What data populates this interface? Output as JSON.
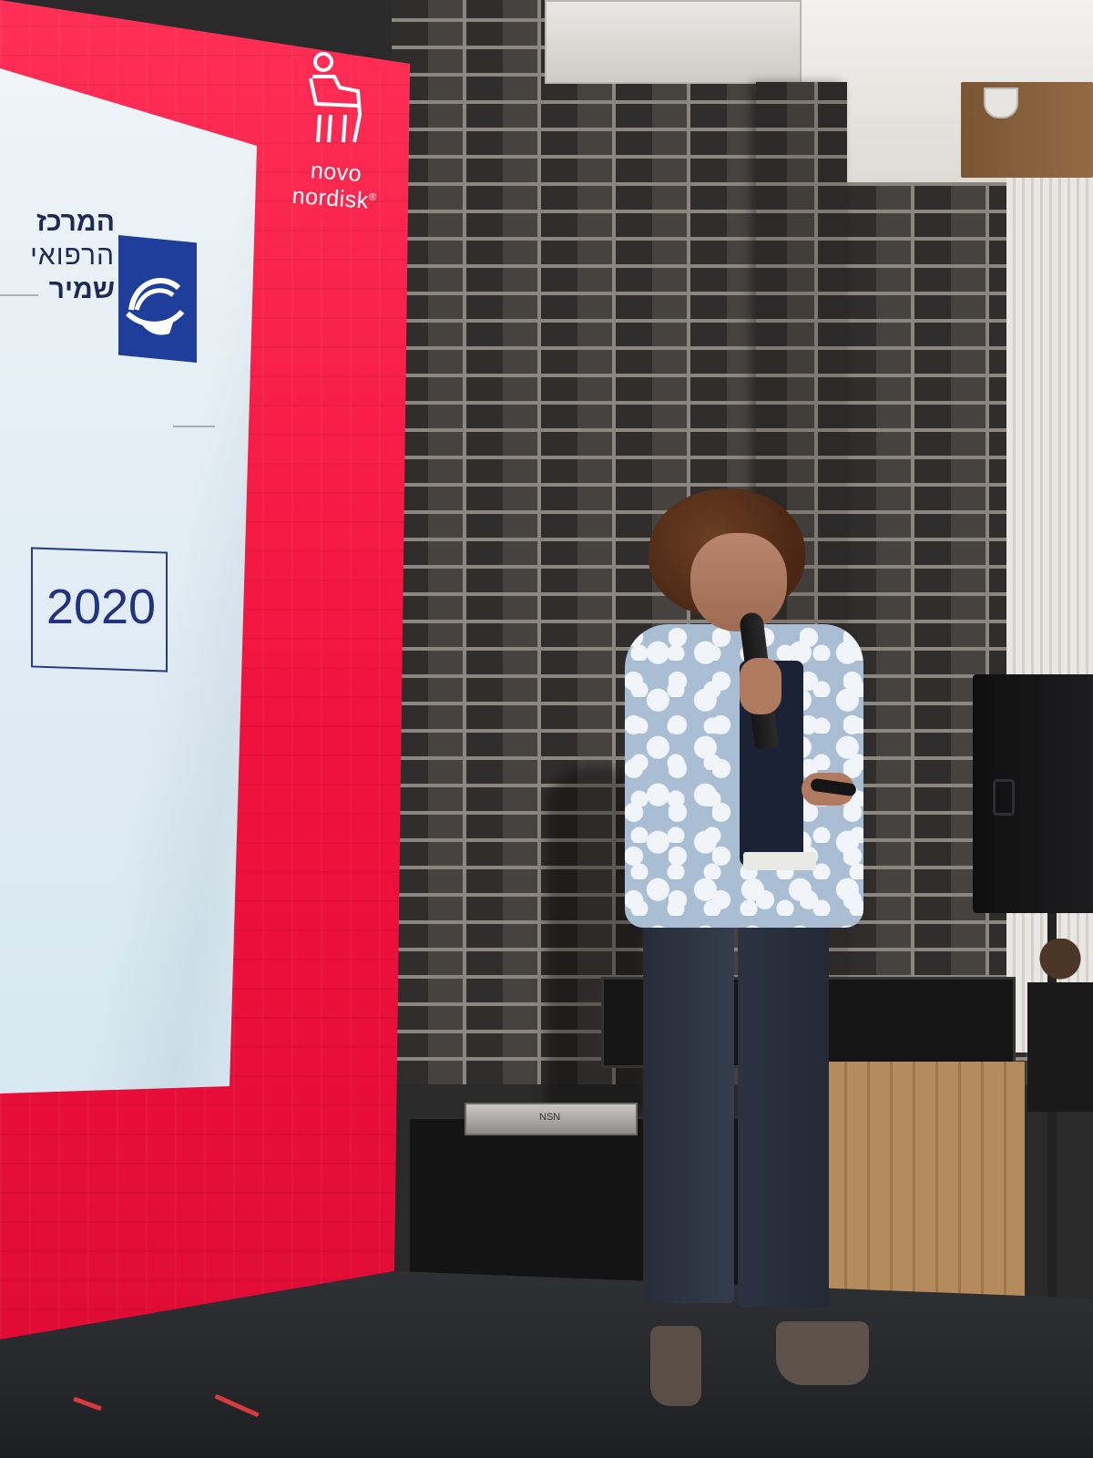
{
  "screen": {
    "sponsor_logo_text": "novo nordisk",
    "sponsor_registered_mark": "®",
    "hospital_name_line1": "המרכז",
    "hospital_name_line2": "הרפואי",
    "hospital_name_line3": "שמיר",
    "year": "2020"
  },
  "equipment": {
    "flight_case_label": "NSN"
  },
  "colors": {
    "screen_red": "#f0123e",
    "slide_navy": "#1e2a55",
    "hospital_logo_blue": "#1f3d9a"
  }
}
